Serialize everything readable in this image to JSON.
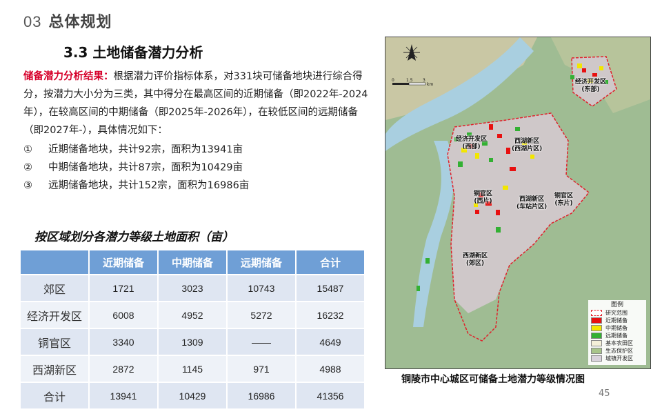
{
  "header": {
    "section_num": "03",
    "section_title": "总体规划"
  },
  "subtitle": "3.3 土地储备潜力分析",
  "intro": {
    "lead": "储备潜力分析结果：",
    "text": "根据潜力评价指标体系，对331块可储备地块进行综合得分，按潜力大小分为三类，其中得分在最高区间的近期储备（即2022年-2024年），在较高区间的中期储备（即2025年-2026年），在较低区间的远期储备（即2027年-），具体情况如下："
  },
  "items": [
    {
      "marker": "①",
      "text": "近期储备地块，共计92宗，面积为13941亩"
    },
    {
      "marker": "②",
      "text": "中期储备地块，共计87宗，面积为10429亩"
    },
    {
      "marker": "③",
      "text": "远期储备地块，共计152宗，面积为16986亩"
    }
  ],
  "table": {
    "title": "按区域划分各潜力等级土地面积（亩）",
    "headers": [
      "",
      "近期储备",
      "中期储备",
      "远期储备",
      "合计"
    ],
    "rows": [
      [
        "郊区",
        "1721",
        "3023",
        "10743",
        "15487"
      ],
      [
        "经济开发区",
        "6008",
        "4952",
        "5272",
        "16232"
      ],
      [
        "铜官区",
        "3340",
        "1309",
        "——",
        "4649"
      ],
      [
        "西湖新区",
        "2872",
        "1145",
        "971",
        "4988"
      ],
      [
        "合计",
        "13941",
        "10429",
        "16986",
        "41356"
      ]
    ]
  },
  "map": {
    "caption": "铜陵市中心城区可储备土地潜力等级情况图",
    "scale_labels": [
      "0",
      "1.5",
      "3",
      "km"
    ],
    "labels": [
      {
        "l1": "经济开发区",
        "l2": "(东部)"
      },
      {
        "l1": "经济开发区",
        "l2": "(西部)"
      },
      {
        "l1": "西湖新区",
        "l2": "(西湖片区)"
      },
      {
        "l1": "铜官区",
        "l2": "(西片)"
      },
      {
        "l1": "西湖新区",
        "l2": "(车站片区)"
      },
      {
        "l1": "铜官区",
        "l2": "(东片)"
      },
      {
        "l1": "西湖新区",
        "l2": "(郊区)"
      }
    ],
    "legend_title": "图例",
    "legend": [
      {
        "label": "研究范围",
        "color": "#e0202a"
      },
      {
        "label": "近期储备",
        "color": "#e81010"
      },
      {
        "label": "中期储备",
        "color": "#f2e600"
      },
      {
        "label": "远期储备",
        "color": "#33b033"
      },
      {
        "label": "基本农田区",
        "color": "#f4f0d8"
      },
      {
        "label": "生态保护区",
        "color": "#a8c48a"
      },
      {
        "label": "城镇开发区",
        "color": "#d9d2dc"
      }
    ]
  },
  "page_number": "45"
}
